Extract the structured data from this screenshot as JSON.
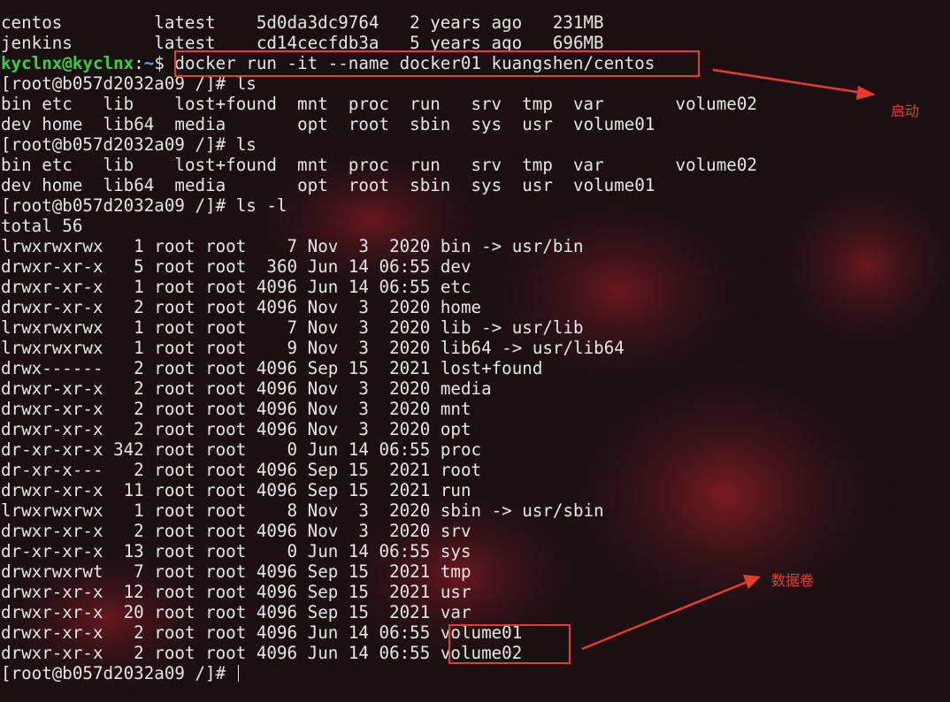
{
  "terminal": {
    "image_rows": [
      {
        "repo": "centos",
        "tag": "latest",
        "id": "5d0da3dc9764",
        "created": "2 years ago",
        "size": "231MB"
      },
      {
        "repo": "jenkins",
        "tag": "latest",
        "id": "cd14cecfdb3a",
        "created": "5 years ago",
        "size": "696MB"
      }
    ],
    "host_prompt_user": "kyclnx@kyclnx",
    "host_prompt_sep": ":",
    "host_prompt_path": "~",
    "host_prompt_symbol": "$ ",
    "run_command": "docker run -it --name docker01 kuangshen/centos",
    "container_prompt": "[root@b057d2032a09 /]# ",
    "cmd_ls": "ls",
    "cmd_ls_l": "ls -l",
    "ls_row1": [
      "bin",
      "etc",
      "lib",
      "lost+found",
      "mnt",
      "proc",
      "run",
      "srv",
      "tmp",
      "var",
      "volume02"
    ],
    "ls_row2": [
      "dev",
      "home",
      "lib64",
      "media",
      "opt",
      "root",
      "sbin",
      "sys",
      "usr",
      "volume01"
    ],
    "total": "total 56",
    "listing": [
      {
        "perm": "lrwxrwxrwx",
        "links": "1",
        "owner": "root",
        "group": "root",
        "size": "7",
        "month": "Nov",
        "day": "3",
        "time": "2020",
        "name": "bin -> usr/bin"
      },
      {
        "perm": "drwxr-xr-x",
        "links": "5",
        "owner": "root",
        "group": "root",
        "size": "360",
        "month": "Jun",
        "day": "14",
        "time": "06:55",
        "name": "dev"
      },
      {
        "perm": "drwxr-xr-x",
        "links": "1",
        "owner": "root",
        "group": "root",
        "size": "4096",
        "month": "Jun",
        "day": "14",
        "time": "06:55",
        "name": "etc"
      },
      {
        "perm": "drwxr-xr-x",
        "links": "2",
        "owner": "root",
        "group": "root",
        "size": "4096",
        "month": "Nov",
        "day": "3",
        "time": "2020",
        "name": "home"
      },
      {
        "perm": "lrwxrwxrwx",
        "links": "1",
        "owner": "root",
        "group": "root",
        "size": "7",
        "month": "Nov",
        "day": "3",
        "time": "2020",
        "name": "lib -> usr/lib"
      },
      {
        "perm": "lrwxrwxrwx",
        "links": "1",
        "owner": "root",
        "group": "root",
        "size": "9",
        "month": "Nov",
        "day": "3",
        "time": "2020",
        "name": "lib64 -> usr/lib64"
      },
      {
        "perm": "drwx------",
        "links": "2",
        "owner": "root",
        "group": "root",
        "size": "4096",
        "month": "Sep",
        "day": "15",
        "time": "2021",
        "name": "lost+found"
      },
      {
        "perm": "drwxr-xr-x",
        "links": "2",
        "owner": "root",
        "group": "root",
        "size": "4096",
        "month": "Nov",
        "day": "3",
        "time": "2020",
        "name": "media"
      },
      {
        "perm": "drwxr-xr-x",
        "links": "2",
        "owner": "root",
        "group": "root",
        "size": "4096",
        "month": "Nov",
        "day": "3",
        "time": "2020",
        "name": "mnt"
      },
      {
        "perm": "drwxr-xr-x",
        "links": "2",
        "owner": "root",
        "group": "root",
        "size": "4096",
        "month": "Nov",
        "day": "3",
        "time": "2020",
        "name": "opt"
      },
      {
        "perm": "dr-xr-xr-x",
        "links": "342",
        "owner": "root",
        "group": "root",
        "size": "0",
        "month": "Jun",
        "day": "14",
        "time": "06:55",
        "name": "proc"
      },
      {
        "perm": "dr-xr-x---",
        "links": "2",
        "owner": "root",
        "group": "root",
        "size": "4096",
        "month": "Sep",
        "day": "15",
        "time": "2021",
        "name": "root"
      },
      {
        "perm": "drwxr-xr-x",
        "links": "11",
        "owner": "root",
        "group": "root",
        "size": "4096",
        "month": "Sep",
        "day": "15",
        "time": "2021",
        "name": "run"
      },
      {
        "perm": "lrwxrwxrwx",
        "links": "1",
        "owner": "root",
        "group": "root",
        "size": "8",
        "month": "Nov",
        "day": "3",
        "time": "2020",
        "name": "sbin -> usr/sbin"
      },
      {
        "perm": "drwxr-xr-x",
        "links": "2",
        "owner": "root",
        "group": "root",
        "size": "4096",
        "month": "Nov",
        "day": "3",
        "time": "2020",
        "name": "srv"
      },
      {
        "perm": "dr-xr-xr-x",
        "links": "13",
        "owner": "root",
        "group": "root",
        "size": "0",
        "month": "Jun",
        "day": "14",
        "time": "06:55",
        "name": "sys"
      },
      {
        "perm": "drwxrwxrwt",
        "links": "7",
        "owner": "root",
        "group": "root",
        "size": "4096",
        "month": "Sep",
        "day": "15",
        "time": "2021",
        "name": "tmp"
      },
      {
        "perm": "drwxr-xr-x",
        "links": "12",
        "owner": "root",
        "group": "root",
        "size": "4096",
        "month": "Sep",
        "day": "15",
        "time": "2021",
        "name": "usr"
      },
      {
        "perm": "drwxr-xr-x",
        "links": "20",
        "owner": "root",
        "group": "root",
        "size": "4096",
        "month": "Sep",
        "day": "15",
        "time": "2021",
        "name": "var"
      },
      {
        "perm": "drwxr-xr-x",
        "links": "2",
        "owner": "root",
        "group": "root",
        "size": "4096",
        "month": "Jun",
        "day": "14",
        "time": "06:55",
        "name": "volume01"
      },
      {
        "perm": "drwxr-xr-x",
        "links": "2",
        "owner": "root",
        "group": "root",
        "size": "4096",
        "month": "Jun",
        "day": "14",
        "time": "06:55",
        "name": "volume02"
      }
    ]
  },
  "annotations": {
    "start_label": "启动",
    "volume_label": "数据卷",
    "color": "#e83a2e"
  }
}
